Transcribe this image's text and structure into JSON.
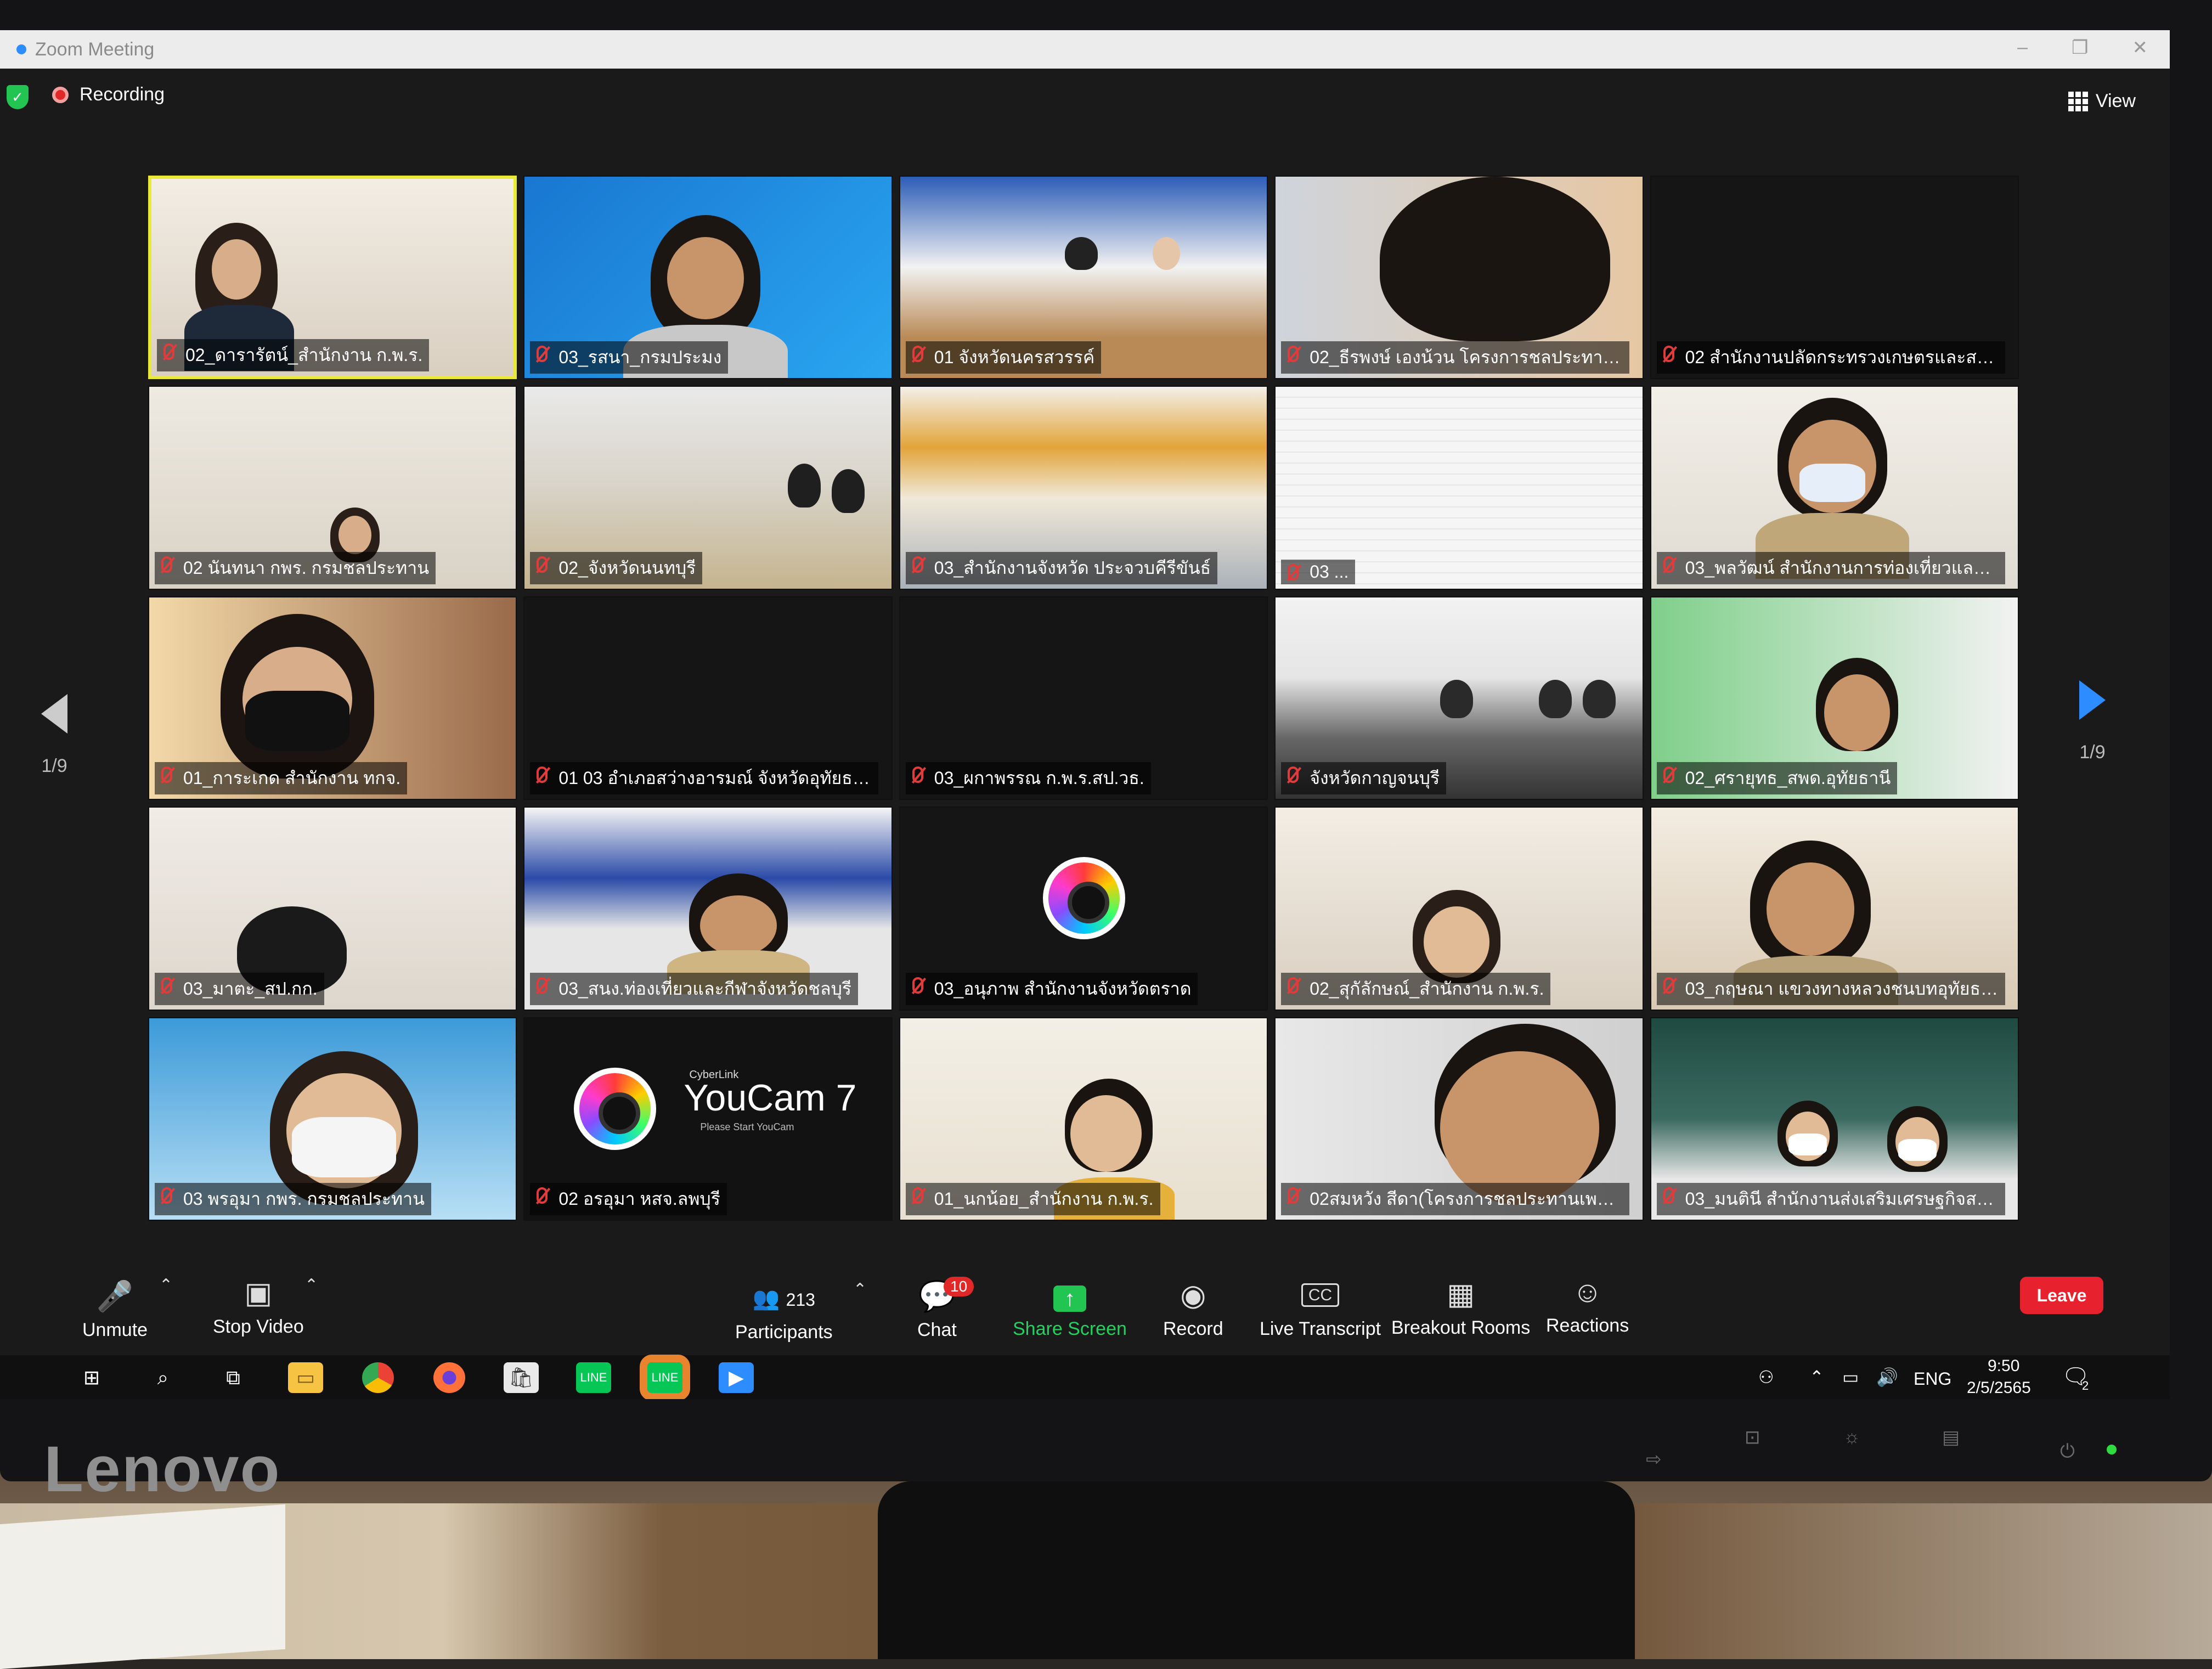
{
  "window": {
    "title": "Zoom Meeting",
    "controls": [
      "–",
      "❐",
      "✕"
    ]
  },
  "topbar": {
    "recording_label": "Recording",
    "view_label": "View"
  },
  "pager": {
    "left": "1/9",
    "right": "1/9"
  },
  "tiles": [
    {
      "name": "02_ดารารัตน์_สำนักงาน ก.พ.ร.",
      "scene": "office-woman",
      "active": true
    },
    {
      "name": "03_รสนา_กรมประมง",
      "scene": "blue-woman"
    },
    {
      "name": "01 จังหวัดนครสวรรค์",
      "scene": "meeting-room-blue"
    },
    {
      "name": "02_ธีรพงษ์ เองน้วน โครงการชลประทานก...",
      "scene": "closeup-man"
    },
    {
      "name": "02 สำนักงานปลัดกระทรวงเกษตรและสหกร",
      "scene": "black"
    },
    {
      "name": "02 นันทนา กพร. กรมชลประทาน",
      "scene": "small-woman"
    },
    {
      "name": "02_จังหวัดนนทบุรี",
      "scene": "conference"
    },
    {
      "name": "03_สำนักงานจังหวัด ประจวบคีรีขันธ์",
      "scene": "curtain-room"
    },
    {
      "name": "03 ...",
      "scene": "white-doc"
    },
    {
      "name": "03_พลวัฒน์ สำนักงานการท่องเที่ยวและกี...",
      "scene": "uniform-man"
    },
    {
      "name": "01_การะเกด สำนักงาน ทกจ.",
      "scene": "mask-woman"
    },
    {
      "name": "01 03 อำเภอสว่างอารมณ์ จังหวัดอุทัยธานี",
      "scene": "black"
    },
    {
      "name": "03_ผกาพรรณ ก.พ.ร.สป.วธ.",
      "scene": "black"
    },
    {
      "name": "จังหวัดกาญจนบุรี",
      "scene": "meeting-hall"
    },
    {
      "name": "02_ศรายุทธ_สพด.อุทัยธานี",
      "scene": "green-man"
    },
    {
      "name": "03_มาตะ_สป.กก.",
      "scene": "empty-chair"
    },
    {
      "name": "03_สนง.ท่องเที่ยวและกีฬาจังหวัดชลบุรี",
      "scene": "office-man"
    },
    {
      "name": "03_อนุภาพ สำนักงานจังหวัดตราด",
      "scene": "youcam-small"
    },
    {
      "name": "02_สุกัลักษณ์_สำนักงาน ก.พ.ร.",
      "scene": "office-woman2"
    },
    {
      "name": "03_กฤษณา แขวงทางหลวงชนบทอุทัยธานี",
      "scene": "mic-woman"
    },
    {
      "name": "03 พรอุมา กพร. กรมชลประทาน",
      "scene": "mask-woman2"
    },
    {
      "name": "02 อรอุมา หสจ.ลพบุรี",
      "scene": "youcam-big",
      "youcam": {
        "brand": "CyberLink",
        "title": "YouCam 7",
        "subtitle": "Please Start YouCam"
      }
    },
    {
      "name": "01_นกน้อย_สำนักงาน ก.พ.ร.",
      "scene": "window-woman"
    },
    {
      "name": "02สมหวัง สีดา(โครงการชลประทานเพชรบุร",
      "scene": "glasses-man"
    },
    {
      "name": "03_มนตินี สำนักงานส่งเสริมเศรษฐกิจสร้า...",
      "scene": "two-women"
    }
  ],
  "toolbar": {
    "unmute": "Unmute",
    "stop_video": "Stop Video",
    "participants": "Participants",
    "participants_count": "213",
    "chat": "Chat",
    "chat_badge": "10",
    "share_screen": "Share Screen",
    "record": "Record",
    "live_transcript": "Live Transcript",
    "cc": "CC",
    "breakout_rooms": "Breakout Rooms",
    "reactions": "Reactions",
    "leave": "Leave"
  },
  "taskbar": {
    "apps": [
      "windows-start",
      "search",
      "task-view",
      "file-explorer",
      "chrome",
      "firefox",
      "store",
      "line",
      "line-active",
      "zoom"
    ],
    "lang": "ENG",
    "time": "9:50",
    "date": "2/5/2565",
    "notif_count": "2"
  },
  "monitor": {
    "brand": "Lenovo"
  },
  "colors": {
    "zoom_blue": "#2d8cff",
    "leave_red": "#e8212e",
    "share_green": "#23c552",
    "active_speaker": "#e9e93a"
  }
}
